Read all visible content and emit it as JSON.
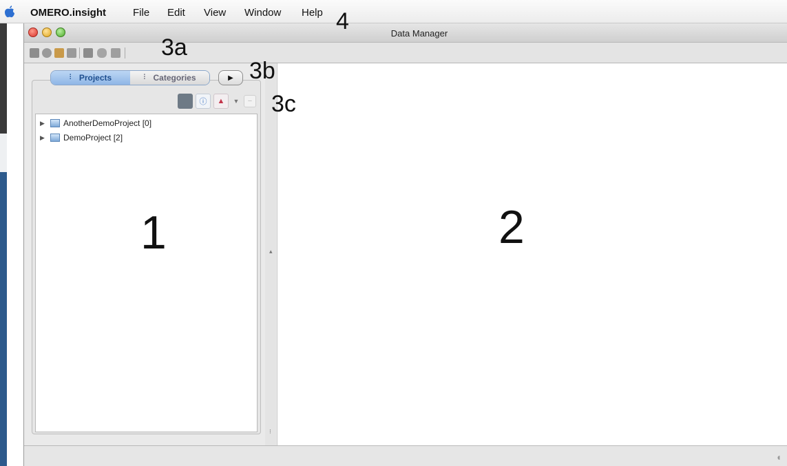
{
  "menubar": {
    "app_name": "OMERO.insight",
    "items": [
      "File",
      "Edit",
      "View",
      "Window",
      "Help"
    ]
  },
  "window": {
    "title": "Data Manager"
  },
  "browser": {
    "tabs": [
      {
        "label": "Projects",
        "active": true
      },
      {
        "label": "Categories",
        "active": false
      }
    ],
    "tree": [
      {
        "label": "AnotherDemoProject [0]"
      },
      {
        "label": "DemoProject [2]"
      }
    ]
  },
  "annotations": {
    "left_panel": "1",
    "right_panel": "2",
    "toolbar": "3a",
    "tabs": "3b",
    "panel_toolbar": "3c",
    "menu": "4"
  },
  "icons": {
    "apple": "apple-logo-icon",
    "toolbar": [
      "view-icon",
      "search-icon",
      "tag-icon",
      "table-icon",
      "filter-icon",
      "annotate-icon",
      "clipboard-icon"
    ],
    "tab_projects": "hierarchy-icon",
    "tab_categories": "category-tree-icon",
    "expand": "play-arrow-icon"
  },
  "colors": {
    "accent": "#8fb6e6",
    "desktop_blue": "#2d5a8c"
  }
}
